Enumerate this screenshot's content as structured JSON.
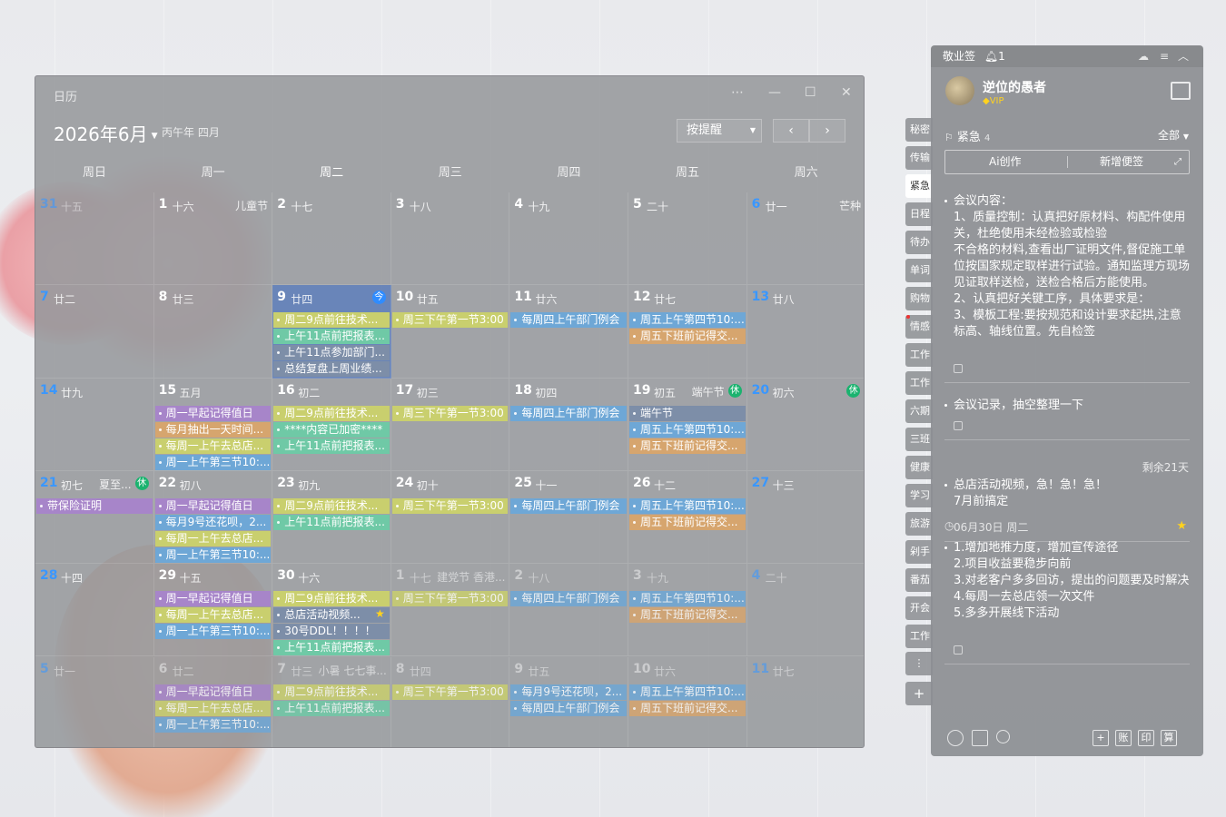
{
  "calendar": {
    "window_title": "日历",
    "month_title": "2026年6月",
    "lunar_month": "丙午年 四月",
    "view_mode": "按提醒",
    "weekdays": [
      "周日",
      "周一",
      "周二",
      "周三",
      "周四",
      "周五",
      "周六"
    ],
    "weeks": [
      [
        {
          "d": "31",
          "l": "十五",
          "dim": true
        },
        {
          "d": "1",
          "l": "十六",
          "f": "儿童节"
        },
        {
          "d": "2",
          "l": "十七"
        },
        {
          "d": "3",
          "l": "十八"
        },
        {
          "d": "4",
          "l": "十九"
        },
        {
          "d": "5",
          "l": "二十"
        },
        {
          "d": "6",
          "l": "廿一",
          "f": "芒种"
        }
      ],
      [
        {
          "d": "7",
          "l": "廿二"
        },
        {
          "d": "8",
          "l": "廿三"
        },
        {
          "d": "9",
          "l": "廿四",
          "today": true,
          "badge": "今",
          "ev": [
            [
              "周二9点前往技术...",
              "y"
            ],
            [
              "上午11点前把报表...",
              "g"
            ],
            [
              "上午11点参加部门...",
              "p"
            ],
            [
              "总结复盘上周业绩...",
              "p"
            ]
          ]
        },
        {
          "d": "10",
          "l": "廿五",
          "ev": [
            [
              "周三下午第一节3:00",
              "y"
            ]
          ]
        },
        {
          "d": "11",
          "l": "廿六",
          "ev": [
            [
              "每周四上午部门例会",
              "b"
            ]
          ]
        },
        {
          "d": "12",
          "l": "廿七",
          "ev": [
            [
              "周五上午第四节10:...",
              "b"
            ],
            [
              "周五下班前记得交...",
              "o"
            ]
          ]
        },
        {
          "d": "13",
          "l": "廿八"
        }
      ],
      [
        {
          "d": "14",
          "l": "廿九"
        },
        {
          "d": "15",
          "l": "五月",
          "ev": [
            [
              "周一早起记得值日",
              "v"
            ],
            [
              "每月抽出一天时间...",
              "o"
            ],
            [
              "每周一上午去总店...",
              "y"
            ],
            [
              "周一上午第三节10:...",
              "b"
            ]
          ]
        },
        {
          "d": "16",
          "l": "初二",
          "ev": [
            [
              "周二9点前往技术...",
              "y"
            ],
            [
              "****内容已加密****",
              "g"
            ],
            [
              "上午11点前把报表...",
              "g"
            ]
          ]
        },
        {
          "d": "17",
          "l": "初三",
          "ev": [
            [
              "周三下午第一节3:00",
              "y"
            ]
          ]
        },
        {
          "d": "18",
          "l": "初四",
          "ev": [
            [
              "每周四上午部门例会",
              "b"
            ]
          ]
        },
        {
          "d": "19",
          "l": "初五",
          "f": "端午节",
          "badge": "休",
          "ev": [
            [
              "端午节",
              "p"
            ],
            [
              "周五上午第四节10:...",
              "b"
            ],
            [
              "周五下班前记得交...",
              "o"
            ]
          ]
        },
        {
          "d": "20",
          "l": "初六",
          "badge": "休"
        }
      ],
      [
        {
          "d": "21",
          "l": "初七",
          "f": "夏至...",
          "badge": "休",
          "ev": [
            [
              "带保险证明",
              "v"
            ]
          ]
        },
        {
          "d": "22",
          "l": "初八",
          "ev": [
            [
              "周一早起记得值日",
              "v"
            ],
            [
              "每月9号还花呗，2...",
              "b"
            ],
            [
              "每周一上午去总店...",
              "y"
            ],
            [
              "周一上午第三节10:...",
              "b"
            ]
          ]
        },
        {
          "d": "23",
          "l": "初九",
          "ev": [
            [
              "周二9点前往技术...",
              "y"
            ],
            [
              "上午11点前把报表...",
              "g"
            ]
          ]
        },
        {
          "d": "24",
          "l": "初十",
          "ev": [
            [
              "周三下午第一节3:00",
              "y"
            ]
          ]
        },
        {
          "d": "25",
          "l": "十一",
          "ev": [
            [
              "每周四上午部门例会",
              "b"
            ]
          ]
        },
        {
          "d": "26",
          "l": "十二",
          "ev": [
            [
              "周五上午第四节10:...",
              "b"
            ],
            [
              "周五下班前记得交...",
              "o"
            ]
          ]
        },
        {
          "d": "27",
          "l": "十三"
        }
      ],
      [
        {
          "d": "28",
          "l": "十四"
        },
        {
          "d": "29",
          "l": "十五",
          "ev": [
            [
              "周一早起记得值日",
              "v"
            ],
            [
              "每周一上午去总店...",
              "y"
            ],
            [
              "周一上午第三节10:...",
              "b"
            ]
          ]
        },
        {
          "d": "30",
          "l": "十六",
          "ev": [
            [
              "周二9点前往技术...",
              "y"
            ],
            [
              "总店活动视频...",
              "p",
              "star"
            ],
            [
              "30号DDL！！！！",
              "p"
            ],
            [
              "上午11点前把报表...",
              "g"
            ]
          ]
        },
        {
          "d": "1",
          "l": "十七",
          "f": "建党节 香港...",
          "dim": true,
          "ev": [
            [
              "周三下午第一节3:00",
              "y"
            ]
          ]
        },
        {
          "d": "2",
          "l": "十八",
          "dim": true,
          "ev": [
            [
              "每周四上午部门例会",
              "b"
            ]
          ]
        },
        {
          "d": "3",
          "l": "十九",
          "dim": true,
          "ev": [
            [
              "周五上午第四节10:...",
              "b"
            ],
            [
              "周五下班前记得交...",
              "o"
            ]
          ]
        },
        {
          "d": "4",
          "l": "二十",
          "dim": true
        }
      ],
      [
        {
          "d": "5",
          "l": "廿一",
          "dim": true
        },
        {
          "d": "6",
          "l": "廿二",
          "dim": true,
          "ev": [
            [
              "周一早起记得值日",
              "v"
            ],
            [
              "每周一上午去总店...",
              "y"
            ],
            [
              "周一上午第三节10:...",
              "b"
            ]
          ]
        },
        {
          "d": "7",
          "l": "廿三",
          "f": "小暑 七七事...",
          "dim": true,
          "ev": [
            [
              "周二9点前往技术...",
              "y"
            ],
            [
              "上午11点前把报表...",
              "g"
            ]
          ]
        },
        {
          "d": "8",
          "l": "廿四",
          "dim": true,
          "ev": [
            [
              "周三下午第一节3:00",
              "y"
            ]
          ]
        },
        {
          "d": "9",
          "l": "廿五",
          "dim": true,
          "ev": [
            [
              "每月9号还花呗，2...",
              "b"
            ],
            [
              "每周四上午部门例会",
              "b"
            ]
          ]
        },
        {
          "d": "10",
          "l": "廿六",
          "dim": true,
          "ev": [
            [
              "周五上午第四节10:...",
              "b"
            ],
            [
              "周五下班前记得交...",
              "o"
            ]
          ]
        },
        {
          "d": "11",
          "l": "廿七",
          "dim": true
        }
      ]
    ],
    "event_colors": {
      "y": "#c9cf6e",
      "g": "#6fc9a6",
      "p": "#7d8ea8",
      "b": "#6ea7d6",
      "o": "#d6a56e",
      "v": "#a785c9"
    }
  },
  "side_tabs": [
    "秘密",
    "传输",
    "紧急",
    "日程",
    "待办",
    "单词",
    "购物",
    "情感",
    "工作",
    "工作",
    "六期",
    "三班",
    "健康",
    "学习",
    "旅游",
    "剁手",
    "番茄",
    "开会",
    "工作"
  ],
  "notes_panel": {
    "app_name": "敬业签",
    "bell_count": "1",
    "user_name": "逆位的愚者",
    "vip_label": "VIP",
    "category": "紧急",
    "category_count": "4",
    "filter": "全部",
    "ai_button": "Ai创作",
    "new_button": "新增便签",
    "notes": [
      {
        "text": "会议内容：\n1、质量控制：认真把好原材料、构配件使用关，杜绝使用未经检验或检验\n不合格的材料,查看出厂证明文件,督促施工单位按国家规定取样进行试验。通知监理方现场见证取样送检，送检合格后方能使用。\n2、认真把好关键工序，具体要求是：\n3、模板工程:要按规范和设计要求起拱,注意标高、轴线位置。先自检签"
      },
      {
        "text": "会议记录，抽空整理一下"
      },
      {
        "remaining": "剩余21天",
        "text": "总店活动视频，急！急！急！\n7月前搞定",
        "meta": "06月30日 周二"
      },
      {
        "text": "1.增加地推力度，增加宣传途径\n2.项目收益要稳步向前\n3.对老客户多多回访，提出的问题要及时解决\n4.每周一去总店领一次文件\n5.多多开展线下活动"
      }
    ],
    "footer_icons": [
      "clock-icon",
      "checklist-icon",
      "search-icon",
      "add-icon",
      "ledger-icon",
      "print-icon",
      "calculator-icon"
    ],
    "footer_labels": {
      "add": "+",
      "ledger": "账",
      "print": "印",
      "calc": "算"
    }
  }
}
